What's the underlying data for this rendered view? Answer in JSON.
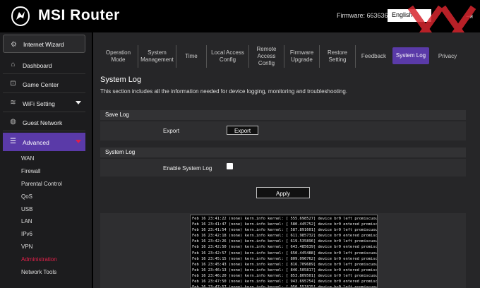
{
  "header": {
    "brand": "MSI Router",
    "firmware_label": "Firmware: 663636",
    "language": "English",
    "logout_icon": "logout-icon",
    "watermark": "XX"
  },
  "sidebar": {
    "wizard": "Internet Wizard",
    "items": [
      {
        "label": "Dashboard",
        "icon": "home-icon"
      },
      {
        "label": "Game Center",
        "icon": "gamepad-icon"
      },
      {
        "label": "WiFi Setting",
        "icon": "wifi-icon"
      },
      {
        "label": "Guest Network",
        "icon": "globe-icon"
      },
      {
        "label": "Advanced",
        "icon": "sliders-icon"
      }
    ],
    "subitems": [
      "WAN",
      "Firewall",
      "Parental Control",
      "QoS",
      "USB",
      "LAN",
      "IPv6",
      "VPN",
      "Administration",
      "Network Tools"
    ]
  },
  "tabs": [
    {
      "l1": "Operation",
      "l2": "Mode",
      "l3": ""
    },
    {
      "l1": "System",
      "l2": "Management",
      "l3": ""
    },
    {
      "l1": "Time",
      "l2": "",
      "l3": ""
    },
    {
      "l1": "Local Access",
      "l2": "Config",
      "l3": ""
    },
    {
      "l1": "Remote",
      "l2": "Access",
      "l3": "Config"
    },
    {
      "l1": "Firmware",
      "l2": "Upgrade",
      "l3": ""
    },
    {
      "l1": "Restore",
      "l2": "Setting",
      "l3": ""
    },
    {
      "l1": "Feedback",
      "l2": "",
      "l3": ""
    },
    {
      "l1": "System Log",
      "l2": "",
      "l3": ""
    },
    {
      "l1": "Privacy",
      "l2": "",
      "l3": ""
    }
  ],
  "page": {
    "title": "System Log",
    "description": "This section includes all the information needed for device logging, monitoring and troubleshooting.",
    "save_log_header": "Save Log",
    "export_label": "Export",
    "export_button": "Export",
    "system_log_header": "System Log",
    "enable_label": "Enable System Log",
    "enable_checked": false,
    "apply_button": "Apply"
  },
  "log_lines": [
    "Feb 16 23:41:22 (none) kern.info kernel: [  555.698527] device br0 left promiscuous mode",
    "Feb 16 23:41:47 (none) kern.info kernel: [  580.445752] device br0 entered promiscuous mod",
    "Feb 16 23:41:54 (none) kern.info kernel: [  587.891601] device br0 left promiscuous mode",
    "Feb 16 23:42:18 (none) kern.info kernel: [  611.985732] device br0 entered promiscuous mod",
    "Feb 16 23:42:26 (none) kern.info kernel: [  619.535896] device br0 left promiscuous mode",
    "Feb 16 23:42:50 (none) kern.info kernel: [  643.485639] device br0 entered promiscuous mod",
    "Feb 16 23:42:57 (none) kern.info kernel: [  650.445488] device br0 left promiscuous mode",
    "Feb 16 23:45:15 (none) kern.info kernel: [  809.096762] device br0 entered promiscuous mod",
    "Feb 16 23:45:43 (none) kern.info kernel: [  816.709689] device br0 left promiscuous mode",
    "Feb 16 23:46:13 (none) kern.info kernel: [  846.505817] device br0 entered promiscuous mod",
    "Feb 16 23:46:20 (none) kern.info kernel: [  853.809501] device br0 left promiscuous mode",
    "Feb 16 23:47:50 (none) kern.info kernel: [  943.695754] device br0 entered promiscuous mod",
    "Feb 16 23:47:57 (none) kern.info kernel: [  950.551815] device br0 left promiscuous mode"
  ]
}
